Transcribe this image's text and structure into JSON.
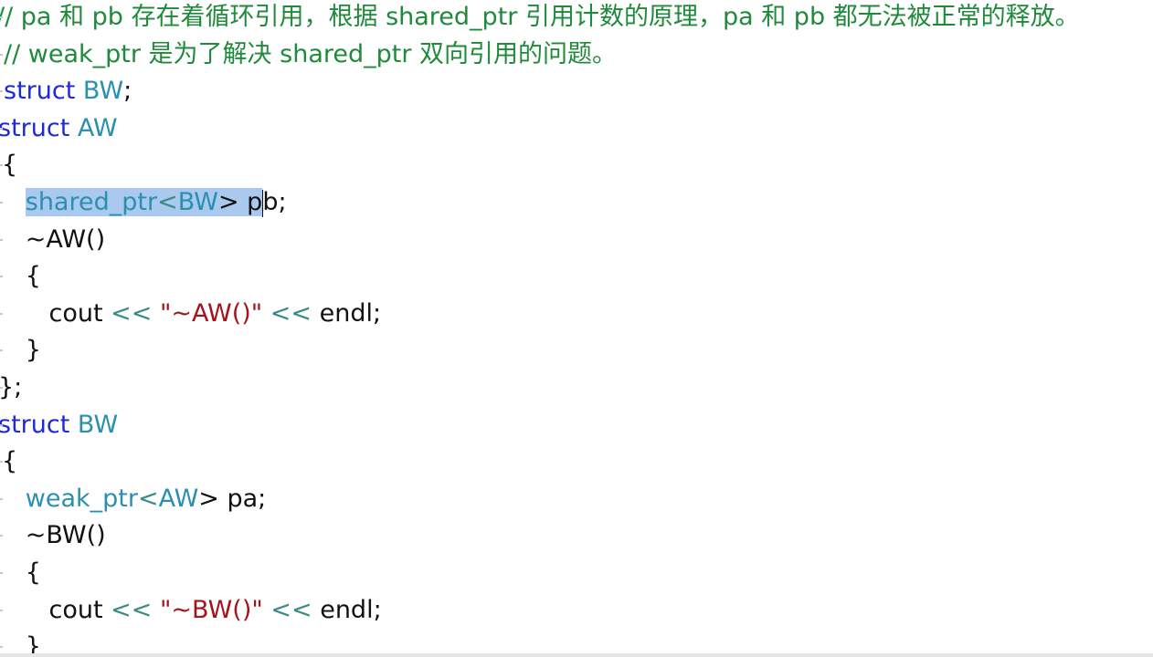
{
  "editor": {
    "lines": [
      [
        {
          "text": "// pa 和 pb 存在着循环引用，根据 shared_ptr 引用计数的原理，pa 和 pb 都无法被正常的释放。",
          "cls": "comment"
        }
      ],
      [
        {
          "text": "// weak_ptr 是为了解决 shared_ptr 双向引用的问题。",
          "cls": "comment"
        }
      ],
      [
        {
          "text": "struct",
          "cls": "kw"
        },
        {
          "text": " BW",
          "cls": "type"
        },
        {
          "text": ";",
          "cls": "plain"
        }
      ],
      [
        {
          "text": "struct",
          "cls": "kw"
        },
        {
          "text": " AW",
          "cls": "type"
        }
      ],
      [
        {
          "text": "{",
          "cls": "plain"
        }
      ],
      [
        {
          "text": "   ",
          "cls": "plain"
        },
        {
          "text": "shared_ptr",
          "cls": "type sel"
        },
        {
          "text": "<",
          "cls": "op sel"
        },
        {
          "text": "BW",
          "cls": "type sel"
        },
        {
          "text": "> p",
          "cls": "plain sel"
        },
        {
          "caret": true
        },
        {
          "text": "b;",
          "cls": "plain"
        }
      ],
      [
        {
          "text": "   ~AW()",
          "cls": "plain"
        }
      ],
      [
        {
          "text": "   {",
          "cls": "plain"
        }
      ],
      [
        {
          "text": "      cout ",
          "cls": "plain"
        },
        {
          "text": "<<",
          "cls": "op"
        },
        {
          "text": " ",
          "cls": "plain"
        },
        {
          "text": "\"~AW()\"",
          "cls": "str"
        },
        {
          "text": " ",
          "cls": "plain"
        },
        {
          "text": "<<",
          "cls": "op"
        },
        {
          "text": " endl;",
          "cls": "plain"
        }
      ],
      [
        {
          "text": "   }",
          "cls": "plain"
        }
      ],
      [
        {
          "text": "};",
          "cls": "plain"
        }
      ],
      [
        {
          "text": "struct",
          "cls": "kw"
        },
        {
          "text": " BW",
          "cls": "type"
        }
      ],
      [
        {
          "text": "{",
          "cls": "plain"
        }
      ],
      [
        {
          "text": "   ",
          "cls": "plain"
        },
        {
          "text": "weak_ptr",
          "cls": "type"
        },
        {
          "text": "<",
          "cls": "op"
        },
        {
          "text": "AW",
          "cls": "type"
        },
        {
          "text": "> pa;",
          "cls": "plain"
        }
      ],
      [
        {
          "text": "   ~BW()",
          "cls": "plain"
        }
      ],
      [
        {
          "text": "   {",
          "cls": "plain"
        }
      ],
      [
        {
          "text": "      cout ",
          "cls": "plain"
        },
        {
          "text": "<<",
          "cls": "op"
        },
        {
          "text": " ",
          "cls": "plain"
        },
        {
          "text": "\"~BW()\"",
          "cls": "str"
        },
        {
          "text": " ",
          "cls": "plain"
        },
        {
          "text": "<<",
          "cls": "op"
        },
        {
          "text": " endl;",
          "cls": "plain"
        }
      ],
      [
        {
          "text": "   }",
          "cls": "plain"
        }
      ]
    ]
  },
  "colors": {
    "comment": "#1f8a3a",
    "keyword": "#1d2ad6",
    "type": "#2b8fb0",
    "operator": "#3a8a86",
    "string": "#a3151c",
    "selection": "#a9c9ef"
  }
}
